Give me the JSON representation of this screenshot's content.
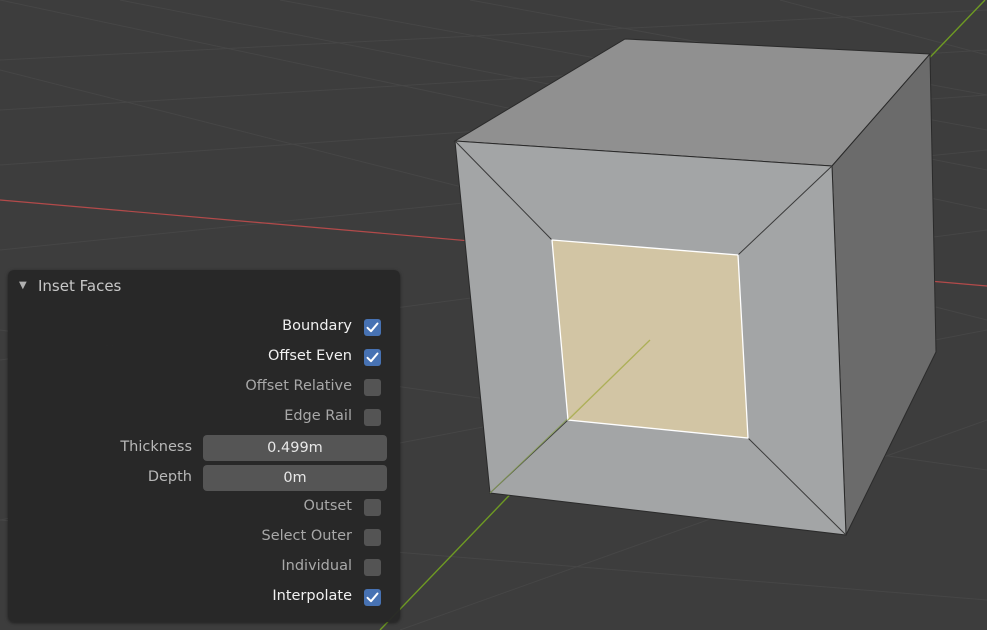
{
  "panel": {
    "title": "Inset Faces",
    "collapse_icon": "disclosure-triangle-down-icon",
    "options": [
      {
        "key": "boundary",
        "label": "Boundary",
        "checked": true
      },
      {
        "key": "offset-even",
        "label": "Offset Even",
        "checked": true
      },
      {
        "key": "offset-relative",
        "label": "Offset Relative",
        "checked": false
      },
      {
        "key": "edge-rail",
        "label": "Edge Rail",
        "checked": false
      }
    ],
    "fields": {
      "thickness": {
        "label": "Thickness",
        "value": "0.499m"
      },
      "depth": {
        "label": "Depth",
        "value": "0m"
      }
    },
    "options2": [
      {
        "key": "outset",
        "label": "Outset",
        "checked": false
      },
      {
        "key": "select-outer",
        "label": "Select Outer",
        "checked": false
      },
      {
        "key": "individual",
        "label": "Individual",
        "checked": false
      },
      {
        "key": "interpolate",
        "label": "Interpolate",
        "checked": true
      }
    ]
  },
  "colors": {
    "viewport_bg": "#3d3d3d",
    "grid_line": "#474747",
    "x_axis": "#b34a4a",
    "y_axis": "#6e9a23",
    "checkbox_on": "#4772b3",
    "checkbox_off": "#545454",
    "selected_face": "#d8c9a4"
  }
}
